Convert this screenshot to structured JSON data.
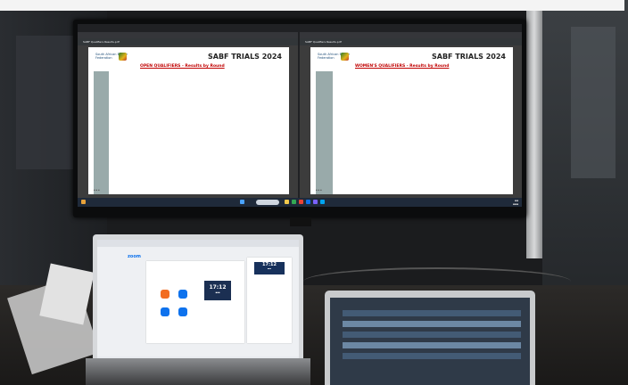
{
  "left_pdf": {
    "tab_title": "SABF Qualifiers Results.pdf",
    "org_name": "South African Bridge Federation",
    "title": "SABF TRIALS 2024",
    "subtitle": "OPEN QUALIFIERS - Results by Round"
  },
  "right_pdf": {
    "tab_title": "SABF Qualifiers Results.pdf",
    "org_name": "South African Bridge Federation",
    "title": "SABF TRIALS 2024",
    "subtitle": "WOMEN'S QUALIFIERS - Results by Round"
  },
  "zoom": {
    "logo": "zoom",
    "clock_time": "17:12",
    "card_time": "17:12"
  },
  "colors": {
    "accent_red": "#c00000",
    "zoom_orange": "#f26d21",
    "zoom_blue": "#0e72ed"
  }
}
